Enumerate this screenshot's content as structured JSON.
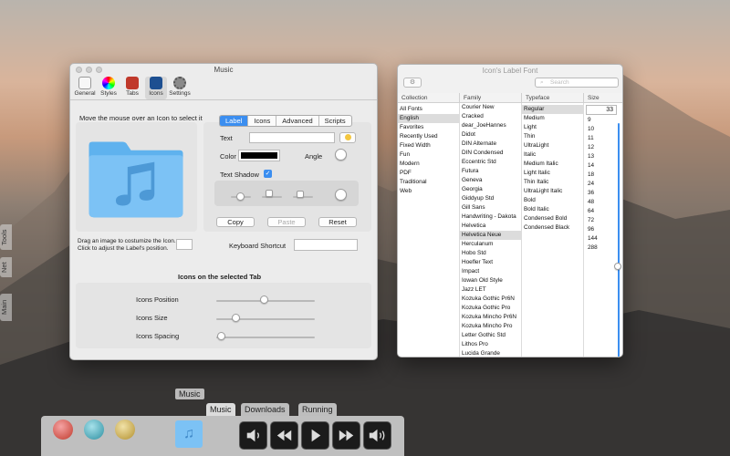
{
  "main_window": {
    "title": "Music",
    "toolbar": [
      "General",
      "Styles",
      "Tabs",
      "Icons",
      "Settings"
    ],
    "hint": "Move the mouse over an Icon to select it",
    "drag_hint_1": "Drag an image to costumize the Icon.",
    "drag_hint_2": "Click to adjust the Label's position.",
    "tabs": [
      "Label",
      "Icons",
      "Advanced",
      "Scripts"
    ],
    "text_label": "Text",
    "color_label": "Color",
    "angle_label": "Angle",
    "shadow_label": "Text Shadow",
    "copy": "Copy",
    "paste": "Paste",
    "reset": "Reset",
    "shortcut_label": "Keyboard Shortcut",
    "section_title": "Icons on the selected Tab",
    "sliders": [
      "Icons Position",
      "Icons Size",
      "Icons Spacing"
    ],
    "slider_values": [
      0.5,
      0.2,
      0.05
    ]
  },
  "font_window": {
    "title": "Icon's Label Font",
    "search_placeholder": "Search",
    "size_value": "33",
    "headers": [
      "Collection",
      "Family",
      "Typeface",
      "Size"
    ],
    "collections": [
      "All Fonts",
      "English",
      "Favorites",
      "Recently Used",
      "Fixed Width",
      "Fun",
      "Modern",
      "PDF",
      "Traditional",
      "Web"
    ],
    "families": [
      "Courier New",
      "Cracked",
      "dear_JoeHannes",
      "Didot",
      "DIN Alternate",
      "DIN Condensed",
      "Eccentric Std",
      "Futura",
      "Geneva",
      "Georgia",
      "Giddyup Std",
      "Gill Sans",
      "Handwriting - Dakota",
      "Helvetica",
      "Helvetica Neue",
      "Herculanum",
      "Hobo Std",
      "Hoefler Text",
      "Impact",
      "Iowan Old Style",
      "Jazz LET",
      "Kozuka Gothic Pr6N",
      "Kozuka Gothic Pro",
      "Kozuka Mincho Pr6N",
      "Kozuka Mincho Pro",
      "Letter Gothic Std",
      "Lithos Pro",
      "Lucida Grande"
    ],
    "typefaces": [
      "Regular",
      "Medium",
      "Light",
      "Thin",
      "UltraLight",
      "Italic",
      "Medium Italic",
      "Light Italic",
      "Thin Italic",
      "UltraLight Italic",
      "Bold",
      "Bold Italic",
      "Condensed Bold",
      "Condensed Black"
    ],
    "sizes": [
      "9",
      "10",
      "11",
      "12",
      "13",
      "14",
      "18",
      "24",
      "36",
      "48",
      "64",
      "72",
      "96",
      "144",
      "288"
    ]
  },
  "dock": {
    "label": "Music",
    "tabs": [
      "Music",
      "Downloads",
      "Running"
    ]
  },
  "side_tabs": [
    "Tools",
    "Net",
    "Main"
  ],
  "colors": {
    "accent": "#3b8ef0",
    "folder": "#7cc2f5"
  }
}
